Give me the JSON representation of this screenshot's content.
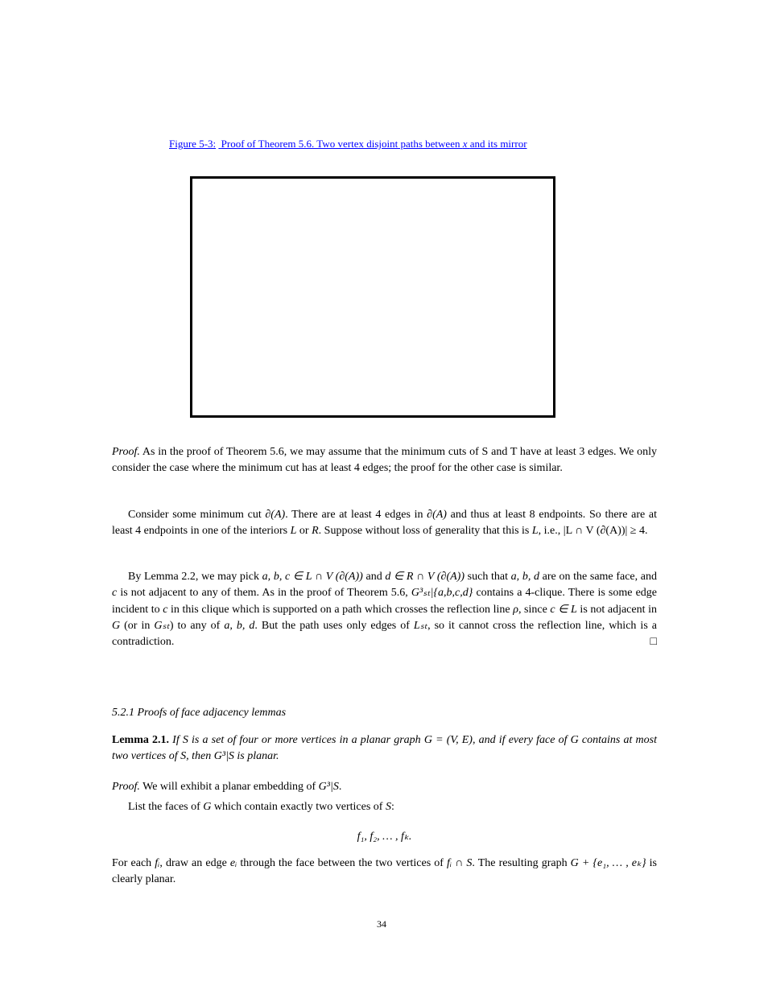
{
  "caption": {
    "prefix": "Figure 5-3:",
    "text": "Proof of Theorem 5.6. Two vertex disjoint paths between",
    "math": "x",
    "suffix": "and its mirror"
  },
  "paragraphs": {
    "p1": "Proof. As in the proof of Theorem 5.6, we may assume that the minimum cuts of S and T have at least 3 edges. We only consider the case where the minimum cut has at least 4 edges; the proof for the other case is similar.",
    "p2_part1": "Consider some minimum cut ",
    "p2_math1": "∂(A)",
    "p2_part2": ". There are at least 4 edges in ",
    "p2_math2": "∂(A)",
    "p2_part3": " and thus at least 8 endpoints. So there are at least 4 endpoints in one of the interiors ",
    "p2_math3": "L",
    "p2_or": " or ",
    "p2_math4": "R",
    "p2_part4": ". Suppose without loss of generality that this is ",
    "p2_math5": "L",
    "p2_part5": ", i.e., ",
    "p2_math6": "|L ∩ V (∂(A))| ≥ 4",
    "p2_part6": ".",
    "p3_part1": "By Lemma 2.2, we may pick ",
    "p3_math1": "a, b, c ∈ L ∩ V (∂(A))",
    "p3_part2": " and ",
    "p3_math2": "d ∈ R ∩ V (∂(A))",
    "p3_part3": " such that ",
    "p3_math3": "a, b, d",
    "p3_part4": " are on the same face, and ",
    "p3_math4": "c",
    "p3_part5": " is not adjacent to any of them. As in the proof of Theorem 5.6, ",
    "p3_math5": "G³ₛₜ|{a,b,c,d}",
    "p3_part6": " contains a 4-clique. There is some edge incident to ",
    "p3_math6": "c",
    "p3_part7": " in this clique which is supported on a path which crosses the reflection line ",
    "p3_math7": "ρ",
    "p3_part8": ", since ",
    "p3_math8": "c ∈ L",
    "p3_part9": " is not adjacent in ",
    "p3_math9": "G",
    "p3_part10": " (or in ",
    "p3_math10": "Gₛₜ",
    "p3_part11": ") to any of ",
    "p3_math11": "a, b, d",
    "p3_part12": ". But the path uses only edges of ",
    "p3_math12": "Lₛₜ",
    "p3_part13": ", so it cannot cross the reflection line, which is a contradiction.",
    "qed": "□"
  },
  "subhead": "5.2.1   Proofs of face adjacency lemmas",
  "lemma": {
    "label": "Lemma 2.1.",
    "italic_part1": " If ",
    "math1": "S",
    "italic_part2": " is a set of four or more vertices in a planar graph ",
    "math2": "G = (V, E)",
    "italic_part3": ", and if every face of ",
    "math3": "G",
    "italic_part4": " contains at most two vertices of ",
    "math4": "S",
    "italic_part5": ", then ",
    "math5": "G³|S",
    "italic_part6": " is planar.",
    "proof_label": "Proof.",
    "proof_part1": " We will exhibit a planar embedding of ",
    "proof_math1": "G³|S",
    "proof_part2": ".",
    "proof2_part1": "List the faces of ",
    "proof2_math1": "G",
    "proof2_part2": " which contain exactly two vertices of ",
    "proof2_math2": "S",
    "proof2_part3": ":",
    "faces_math": "f₁, f₂, … , fₖ.",
    "proof3_part1": "For each ",
    "proof3_math1": "fᵢ",
    "proof3_part2": ", draw an edge ",
    "proof3_math2": "eᵢ",
    "proof3_part3": " through the face between the two vertices of ",
    "proof3_math3": "fᵢ ∩ S",
    "proof3_part4": ". The resulting graph ",
    "proof3_math4": "G + {e₁, … , eₖ}",
    "proof3_part5": " is clearly planar."
  },
  "page_number": "34"
}
